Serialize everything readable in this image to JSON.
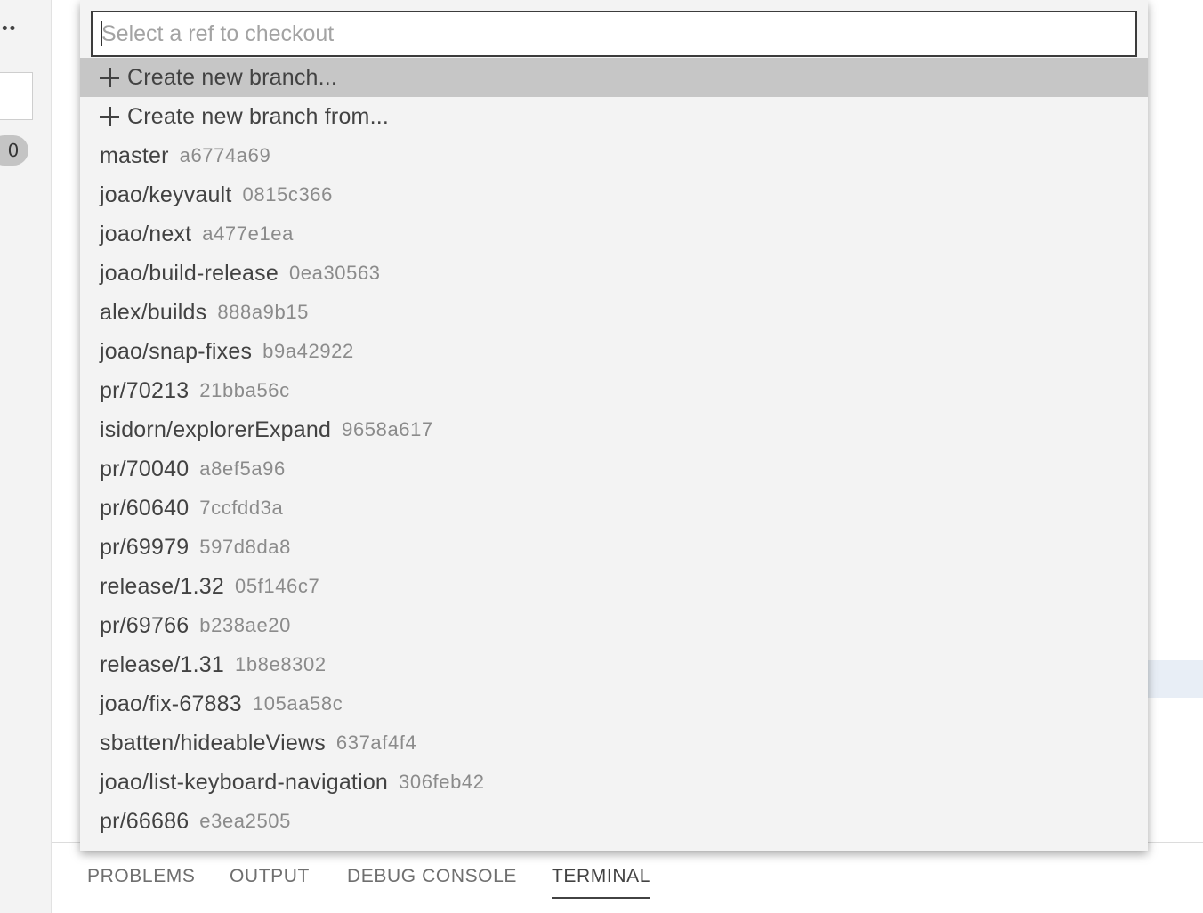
{
  "sidebar": {
    "more_icon": "ellipsis-icon",
    "count_badge": "0"
  },
  "panel": {
    "tabs": [
      {
        "label": "PROBLEMS",
        "active": false
      },
      {
        "label": "OUTPUT",
        "active": false
      },
      {
        "label": "DEBUG CONSOLE",
        "active": false
      },
      {
        "label": "TERMINAL",
        "active": true
      }
    ]
  },
  "quick_pick": {
    "placeholder": "Select a ref to checkout",
    "value": "",
    "actions": [
      {
        "label": "Create new branch...",
        "icon": "plus-icon",
        "selected": true
      },
      {
        "label": "Create new branch from...",
        "icon": "plus-icon",
        "selected": false
      }
    ],
    "refs": [
      {
        "name": "master",
        "hash": "a6774a69"
      },
      {
        "name": "joao/keyvault",
        "hash": "0815c366"
      },
      {
        "name": "joao/next",
        "hash": "a477e1ea"
      },
      {
        "name": "joao/build-release",
        "hash": "0ea30563"
      },
      {
        "name": "alex/builds",
        "hash": "888a9b15"
      },
      {
        "name": "joao/snap-fixes",
        "hash": "b9a42922"
      },
      {
        "name": "pr/70213",
        "hash": "21bba56c"
      },
      {
        "name": "isidorn/explorerExpand",
        "hash": "9658a617"
      },
      {
        "name": "pr/70040",
        "hash": "a8ef5a96"
      },
      {
        "name": "pr/60640",
        "hash": "7ccfdd3a"
      },
      {
        "name": "pr/69979",
        "hash": "597d8da8"
      },
      {
        "name": "release/1.32",
        "hash": "05f146c7"
      },
      {
        "name": "pr/69766",
        "hash": "b238ae20"
      },
      {
        "name": "release/1.31",
        "hash": "1b8e8302"
      },
      {
        "name": "joao/fix-67883",
        "hash": "105aa58c"
      },
      {
        "name": "sbatten/hideableViews",
        "hash": "637af4f4"
      },
      {
        "name": "joao/list-keyboard-navigation",
        "hash": "306feb42"
      },
      {
        "name": "pr/66686",
        "hash": "e3ea2505"
      }
    ]
  }
}
